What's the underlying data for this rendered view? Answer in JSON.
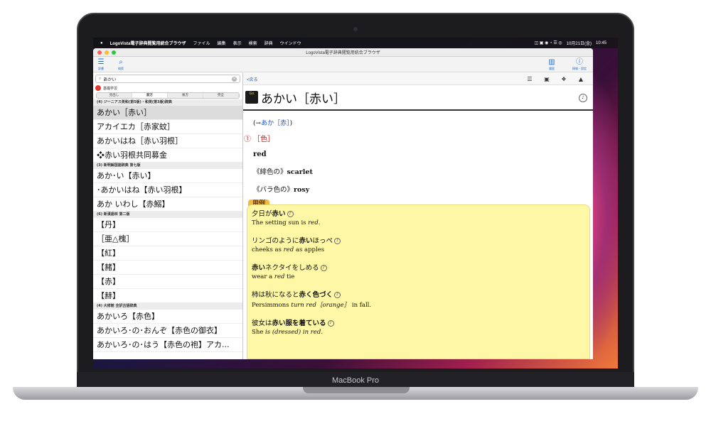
{
  "device": {
    "brand": "MacBook Pro"
  },
  "menubar": {
    "apple": "",
    "app_name": "LogoVista電子辞典閲覧用統合ブラウザ",
    "menus": [
      "ファイル",
      "編集",
      "表示",
      "検索",
      "辞典",
      "ウインドウ"
    ],
    "date": "10月21日(金)",
    "time": "10:45"
  },
  "window": {
    "title": "LogoVista電子辞典閲覧用統合ブラウザ",
    "toolbar": {
      "dict_label": "辞書",
      "search_label": "検索",
      "history_label": "履歴",
      "info_label": "情報・設定"
    }
  },
  "sidebar": {
    "search_value": "あかい",
    "category": "基礎学習",
    "segments": [
      "見出し",
      "前方",
      "後方",
      "完全"
    ],
    "active_segment": 1,
    "groups": [
      {
        "title": "(4) ジーニアス英和(第5版)・和英(第3版)辞典",
        "entries": [
          "あかい［赤い］",
          "アカイエカ［赤家蚊］",
          "あかいはね［赤い羽根］",
          "❖赤い羽根共同募金"
        ]
      },
      {
        "title": "(3) 新明解国語辞典 第七版",
        "entries": [
          "あか･い【赤い】",
          "･あかいはね【赤い羽根】",
          "あか いわし【赤鰯】"
        ]
      },
      {
        "title": "(6) 新漢語林 第二版",
        "entries": [
          "【丹】",
          "［亜△槐］",
          "【紅】",
          "【赭】",
          "【赤】",
          "【赫】"
        ]
      },
      {
        "title": "(4) 大修館 全訳古語辞典",
        "entries": [
          "あかいろ【赤色】",
          "あかいろ･の･おんぞ【赤色の御衣】",
          "あかいろ･の･はう【赤色の袍】アカ..."
        ]
      }
    ]
  },
  "main": {
    "back_label": "<戻る",
    "dict_logo": "Gx",
    "headword": "あかい［赤い］",
    "ref_prefix": "(→",
    "ref_link": "あか［赤］",
    "ref_suffix": ")",
    "sense_label": "① ［色］",
    "gloss_main": "red",
    "gloss_1_ja": "《緋色の》",
    "gloss_1_en": "scarlet",
    "gloss_2_ja": "《バラ色の》",
    "gloss_2_en": "rosy",
    "examples_label": "用例",
    "examples": [
      {
        "ja_pre": "夕日が",
        "ja_bold": "赤い",
        "ja_post": "",
        "en_pre": "The setting sun is ",
        "en_ital": "red",
        "en_post": "."
      },
      {
        "ja_pre": "リンゴのように",
        "ja_bold": "赤い",
        "ja_post": "ほっぺ",
        "en_pre": "cheeks as ",
        "en_ital": "red",
        "en_post": " as apples"
      },
      {
        "ja_pre": "",
        "ja_bold": "赤い",
        "ja_post": "ネクタイをしめる",
        "en_pre": "wear a ",
        "en_ital": "red",
        "en_post": " tie"
      },
      {
        "ja_pre": "柿は秋になると",
        "ja_bold": "赤く色づく",
        "ja_post": "",
        "en_pre": "Persimmons ",
        "en_ital": "turn red［orange］",
        "en_post": " in fall."
      },
      {
        "ja_pre": "彼女は",
        "ja_bold": "赤い服を着ている",
        "ja_post": "",
        "en_pre": "She ",
        "en_ital": "is (dressed) in red",
        "en_post": "."
      }
    ]
  }
}
